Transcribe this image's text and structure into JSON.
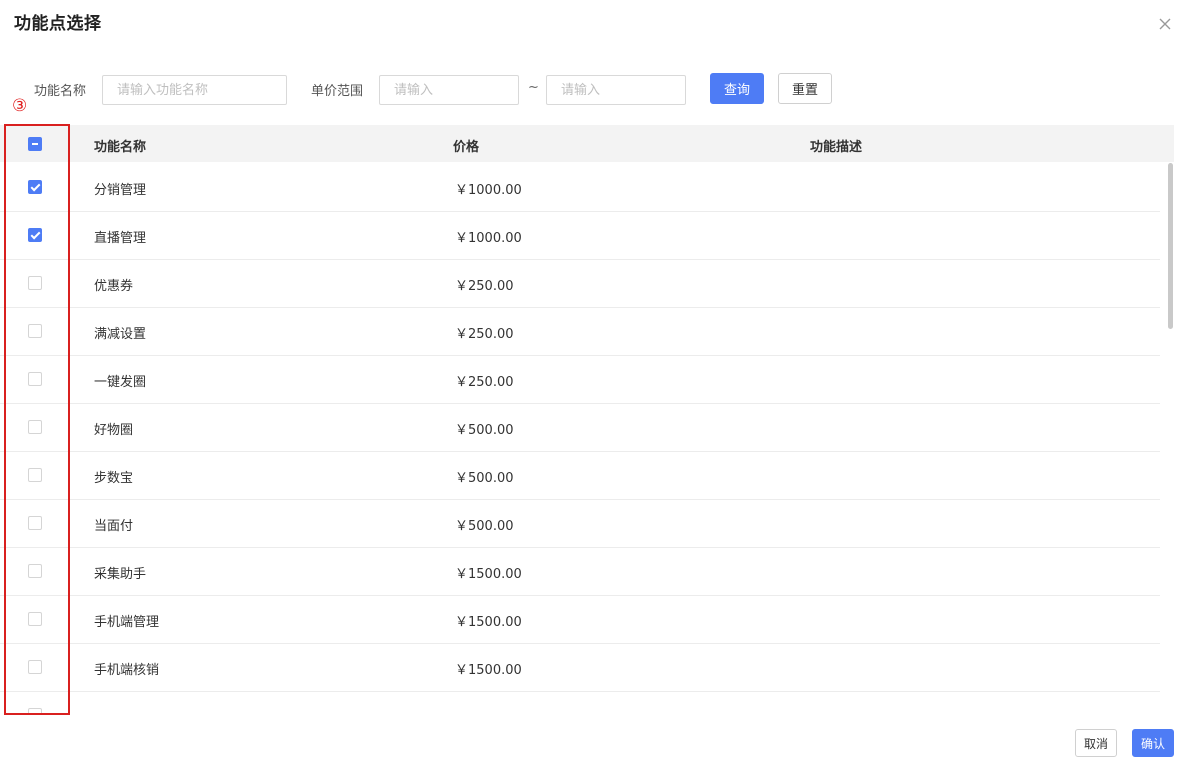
{
  "dialog": {
    "title": "功能点选择"
  },
  "filters": {
    "name_label": "功能名称",
    "name_placeholder": "请输入功能名称",
    "price_label": "单价范围",
    "price_min_placeholder": "请输入",
    "price_separator": "~",
    "price_max_placeholder": "请输入",
    "search_label": "查询",
    "reset_label": "重置"
  },
  "annotation": {
    "marker": "③",
    "color": "#d9201f"
  },
  "table": {
    "headers": {
      "name": "功能名称",
      "price": "价格",
      "description": "功能描述"
    },
    "select_all_state": "indeterminate",
    "rows": [
      {
        "name": "分销管理",
        "price": "￥1000.00",
        "checked": true
      },
      {
        "name": "直播管理",
        "price": "￥1000.00",
        "checked": true
      },
      {
        "name": "优惠券",
        "price": "￥250.00",
        "checked": false
      },
      {
        "name": "满减设置",
        "price": "￥250.00",
        "checked": false
      },
      {
        "name": "一键发圈",
        "price": "￥250.00",
        "checked": false
      },
      {
        "name": "好物圈",
        "price": "￥500.00",
        "checked": false
      },
      {
        "name": "步数宝",
        "price": "￥500.00",
        "checked": false
      },
      {
        "name": "当面付",
        "price": "￥500.00",
        "checked": false
      },
      {
        "name": "采集助手",
        "price": "￥1500.00",
        "checked": false
      },
      {
        "name": "手机端管理",
        "price": "￥1500.00",
        "checked": false
      },
      {
        "name": "手机端核销",
        "price": "￥1500.00",
        "checked": false
      },
      {
        "name": "",
        "price": "",
        "checked": false
      }
    ]
  },
  "footer": {
    "cancel_label": "取消",
    "confirm_label": "确认"
  },
  "colors": {
    "primary": "#4e7cf5",
    "header_bg": "#f3f3f3",
    "annotation": "#d9201f"
  }
}
